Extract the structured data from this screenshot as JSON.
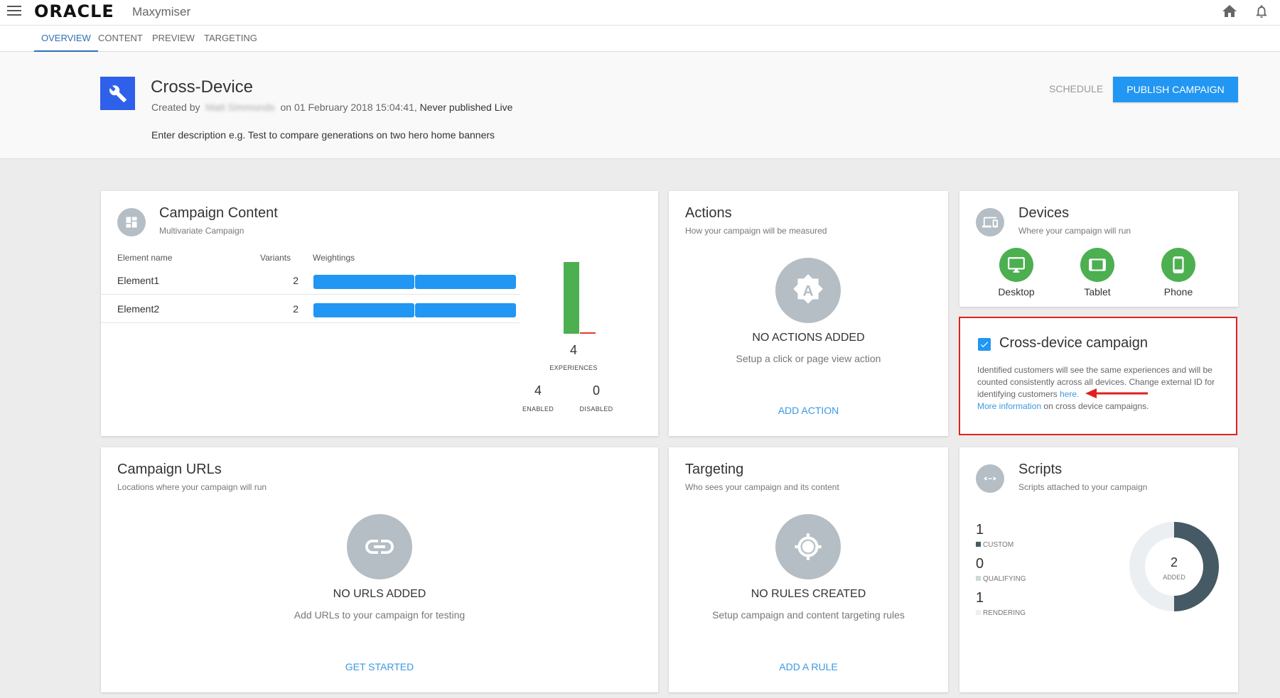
{
  "app": {
    "brand": "ORACLE",
    "product": "Maxymiser"
  },
  "tabs": [
    {
      "label": "OVERVIEW",
      "active": true
    },
    {
      "label": "CONTENT",
      "active": false
    },
    {
      "label": "PREVIEW",
      "active": false
    },
    {
      "label": "TARGETING",
      "active": false
    }
  ],
  "campaign": {
    "title": "Cross-Device",
    "created_prefix": "Created by",
    "author": "Matt Simmonds",
    "created_suffix": "on 01 February 2018 15:04:41,",
    "status": "Never published Live",
    "description": "Enter description e.g. Test to compare generations on two hero home banners"
  },
  "header_actions": {
    "schedule": "SCHEDULE",
    "publish": "PUBLISH CAMPAIGN"
  },
  "content_card": {
    "title": "Campaign Content",
    "subtitle": "Multivariate Campaign",
    "headers": {
      "name": "Element name",
      "variants": "Variants",
      "weightings": "Weightings"
    },
    "rows": [
      {
        "name": "Element1",
        "variants": "2",
        "weightings": [
          0.5,
          0.5
        ]
      },
      {
        "name": "Element2",
        "variants": "2",
        "weightings": [
          0.5,
          0.5
        ]
      }
    ],
    "experiences": {
      "total": "4",
      "label": "EXPERIENCES",
      "enabled": "4",
      "enabled_label": "ENABLED",
      "disabled": "0",
      "disabled_label": "DISABLED"
    }
  },
  "actions_card": {
    "title": "Actions",
    "subtitle": "How your campaign will be measured",
    "empty_title": "NO ACTIONS ADDED",
    "empty_sub": "Setup a click or page view action",
    "button": "ADD ACTION",
    "icon_letter": "A"
  },
  "devices_card": {
    "title": "Devices",
    "subtitle": "Where your campaign will run",
    "devices": [
      {
        "label": "Desktop",
        "icon": "desktop-icon"
      },
      {
        "label": "Tablet",
        "icon": "tablet-icon"
      },
      {
        "label": "Phone",
        "icon": "phone-icon"
      }
    ]
  },
  "cross_device": {
    "title": "Cross-device campaign",
    "checked": true,
    "text1": "Identified customers will see the same experiences and will be counted consistently across all devices. Change external ID for identifying customers",
    "here_link": "here.",
    "more_link": "More information",
    "text2": "on cross device campaigns."
  },
  "urls_card": {
    "title": "Campaign URLs",
    "subtitle": "Locations where your campaign will run",
    "empty_title": "NO URLS ADDED",
    "empty_sub": "Add URLs to your campaign for testing",
    "button": "GET STARTED"
  },
  "targeting_card": {
    "title": "Targeting",
    "subtitle": "Who sees your campaign and its content",
    "empty_title": "NO RULES CREATED",
    "empty_sub": "Setup campaign and content targeting rules",
    "button": "ADD A RULE"
  },
  "scripts_card": {
    "title": "Scripts",
    "subtitle": "Scripts attached to your campaign",
    "stats": [
      {
        "value": "1",
        "label": "CUSTOM",
        "color": "#455a64"
      },
      {
        "value": "0",
        "label": "QUALIFYING",
        "color": "#cfd8dc"
      },
      {
        "value": "1",
        "label": "RENDERING",
        "color": "#eceff1"
      }
    ],
    "donut": {
      "total": "2",
      "label": "ADDED",
      "custom": 1,
      "rendering": 1
    }
  },
  "colors": {
    "primary": "#2196f3",
    "device_green": "#4caf50",
    "icon_grey": "#b4bec4",
    "highlight_red": "#e02020"
  }
}
